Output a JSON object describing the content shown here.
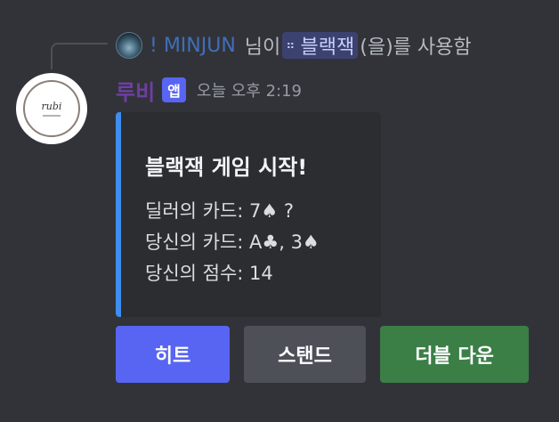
{
  "reply": {
    "username": "! MINJUN",
    "text_before": "님이",
    "command": "블랙잭",
    "text_after": "(을)를 사용함"
  },
  "message": {
    "username": "루비",
    "badge": "앱",
    "timestamp": "오늘 오후 2:19",
    "avatar_logo": "rubi"
  },
  "embed": {
    "accent_color": "#3d8ef0",
    "title": "블랙잭 게임 시작!",
    "lines": [
      "딜러의 카드: 7♠ ?",
      "당신의 카드: A♣, 3♠",
      "당신의 점수: 14"
    ]
  },
  "buttons": {
    "hit": "히트",
    "stand": "스탠드",
    "double_down": "더블 다운"
  },
  "colors": {
    "background": "#323339",
    "hit_button": "#5865f2",
    "stand_button": "#4e5058",
    "double_down_button": "#3b7f47",
    "username": "#6e3fa1",
    "app_badge": "#5865f2"
  }
}
